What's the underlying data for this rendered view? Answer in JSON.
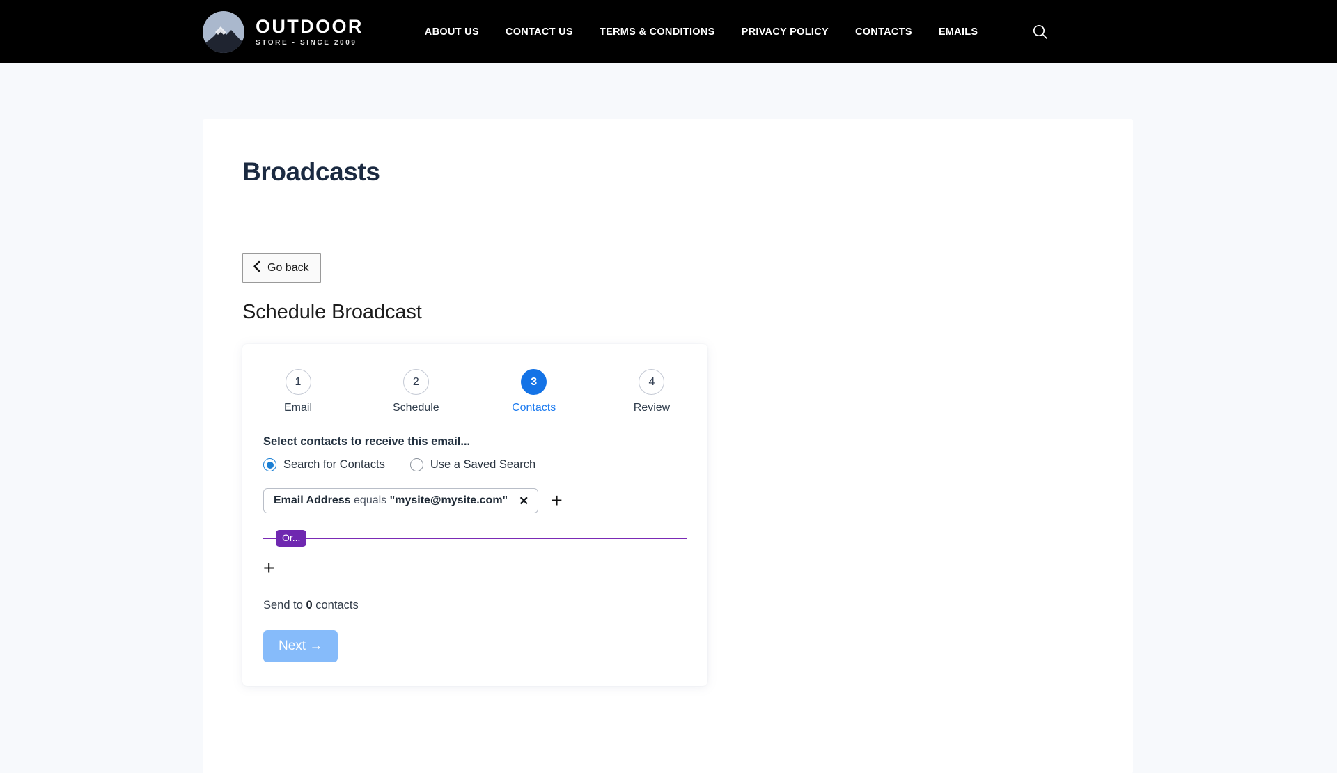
{
  "site": {
    "brand": {
      "logo_icon": "mountain-circle-logo",
      "title": "OUTDOOR",
      "subtitle": "STORE - SINCE 2009"
    },
    "nav": [
      {
        "label": "ABOUT US"
      },
      {
        "label": "CONTACT US"
      },
      {
        "label": "TERMS & CONDITIONS"
      },
      {
        "label": "PRIVACY POLICY"
      },
      {
        "label": "CONTACTS"
      },
      {
        "label": "EMAILS"
      }
    ],
    "search_icon": "search-icon"
  },
  "page": {
    "title": "Broadcasts",
    "go_back_label": "Go back",
    "go_back_icon": "chevron-left-icon",
    "section_title": "Schedule Broadcast"
  },
  "wizard": {
    "steps": [
      {
        "number": "1",
        "label": "Email",
        "active": false
      },
      {
        "number": "2",
        "label": "Schedule",
        "active": false
      },
      {
        "number": "3",
        "label": "Contacts",
        "active": true
      },
      {
        "number": "4",
        "label": "Review",
        "active": false
      }
    ],
    "prompt": "Select contacts to receive this email...",
    "radio_options": [
      {
        "label": "Search for Contacts",
        "selected": true
      },
      {
        "label": "Use a Saved Search",
        "selected": false
      }
    ],
    "criteria": [
      {
        "field": "Email Address",
        "operator": "equals",
        "value": "\"mysite@mysite.com\"",
        "remove_icon": "close-icon"
      }
    ],
    "add_criterion_icon": "plus-icon",
    "or_badge_label": "Or...",
    "add_group_icon": "plus-icon",
    "send_summary": {
      "prefix": "Send to ",
      "count": "0",
      "suffix": " contacts"
    },
    "next_label": "Next →"
  },
  "colors": {
    "nav_background": "#000000",
    "page_background": "#f7f9fc",
    "panel_background": "#ffffff",
    "title_color": "#1b2a41",
    "active_step": "#1473e6",
    "active_step_label": "#1e7cf0",
    "radio_selected": "#1b7fd4",
    "or_purple": "#6f28b0",
    "next_button": "#86bbfa",
    "logo_circle": "#aab8cd"
  }
}
